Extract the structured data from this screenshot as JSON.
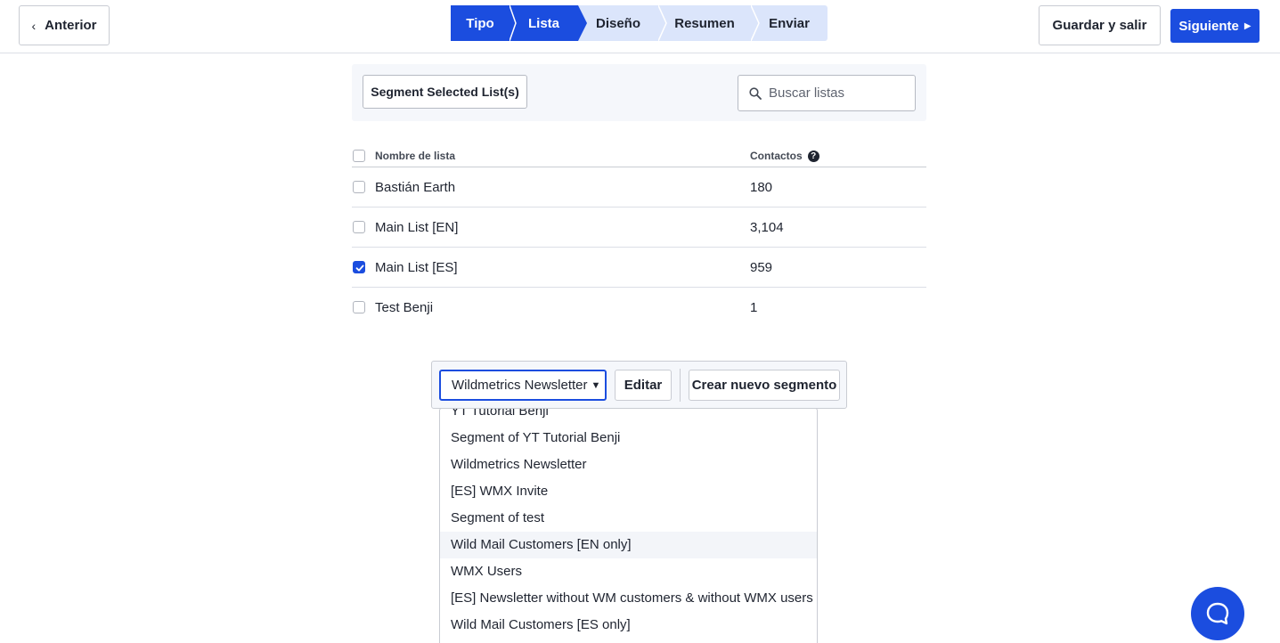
{
  "header": {
    "prev_label": "Anterior",
    "steps": [
      {
        "label": "Tipo",
        "state": "active"
      },
      {
        "label": "Lista",
        "state": "active"
      },
      {
        "label": "Diseño",
        "state": "inactive"
      },
      {
        "label": "Resumen",
        "state": "inactive"
      },
      {
        "label": "Enviar",
        "state": "inactive"
      }
    ],
    "save_label": "Guardar y salir",
    "next_label": "Siguiente"
  },
  "toolbar": {
    "segment_button_label": "Segment Selected List(s)",
    "search_placeholder": "Buscar listas"
  },
  "table": {
    "columns": {
      "name": "Nombre de lista",
      "contacts": "Contactos"
    },
    "rows": [
      {
        "name": "Bastián Earth",
        "contacts": "180",
        "checked": false
      },
      {
        "name": "Main List [EN]",
        "contacts": "3,104",
        "checked": false
      },
      {
        "name": "Main List [ES]",
        "contacts": "959",
        "checked": true
      },
      {
        "name": "Test Benji",
        "contacts": "1",
        "checked": false
      }
    ]
  },
  "segment_bar": {
    "selected": "Wildmetrics Newsletter",
    "edit_label": "Editar",
    "new_label": "Crear nuevo segmento"
  },
  "dropdown": {
    "options": [
      "YT Tutorial Benji",
      "Segment of YT Tutorial Benji",
      "Wildmetrics Newsletter",
      "[ES] WMX Invite",
      "Segment of test",
      "Wild Mail Customers [EN only]",
      "WMX Users",
      "[ES] Newsletter without WM customers & without WMX users",
      "Wild Mail Customers [ES only]"
    ],
    "hovered_index": 5
  },
  "colors": {
    "accent": "#1b4ddf",
    "step_inactive": "#dbe5fb",
    "panel": "#f5f7fb"
  },
  "icons": {
    "prev": "chevron-left-icon",
    "next": "caret-right-icon",
    "search": "search-icon",
    "help": "question-circle-icon",
    "chat": "chat-bubble-icon"
  }
}
